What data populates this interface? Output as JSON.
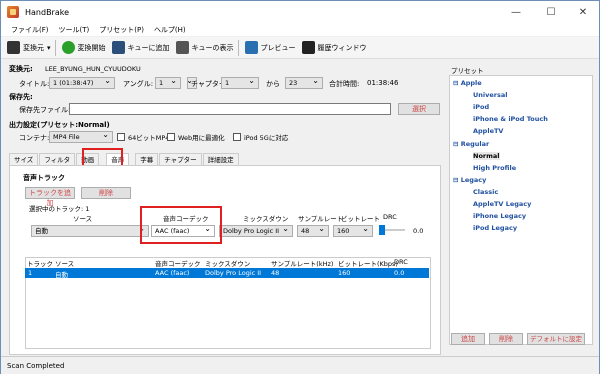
{
  "app": {
    "title": "HandBrake"
  },
  "menu": [
    "ファイル(F)",
    "ツール(T)",
    "プリセット(P)",
    "ヘルプ(H)"
  ],
  "toolbar": {
    "source": "変換元",
    "start": "変換開始",
    "add_queue": "キューに追加",
    "show_queue": "キューの表示",
    "preview": "プレビュー",
    "activity": "履歴ウィンドウ"
  },
  "source": {
    "label": "変換元:",
    "value": "LEE_BYUNG_HUN_CYUUDOKU",
    "title_label": "タイトル:",
    "title_value": "1 (01:38:47)",
    "angle_label": "アングル:",
    "angle_value": "1",
    "chapter_label": "チャプター:",
    "chapter_from": "1",
    "chapter_to_label": "から",
    "chapter_to": "23",
    "total_label": "合計時間:",
    "total_value": "01:38:46"
  },
  "destination": {
    "section": "保存先:",
    "file_label": "保存先ファイル:",
    "browse": "選択"
  },
  "output": {
    "section": "出力設定(プリセット:Normal)",
    "container_label": "コンテナ:",
    "container_value": "MP4 File",
    "opt_64bit": "64ビットMP4",
    "opt_web": "Web用に最適化",
    "opt_ipod": "iPod 5Gに対応"
  },
  "tabs": [
    "サイズ",
    "フィルタ",
    "動画",
    "音声",
    "字幕",
    "チャプター",
    "詳細設定"
  ],
  "audio": {
    "section": "音声トラック",
    "add_track": "トラックを追加",
    "remove": "削除",
    "selected_label": "選択中のトラック: 1",
    "col_source": "ソース",
    "col_codec": "音声コーデック",
    "col_mixdown": "ミックスダウン",
    "col_samplerate": "サンプルレート",
    "col_bitrate": "ビットレート",
    "col_drc": "DRC",
    "source_value": "自動",
    "codec_value": "AAC (faac)",
    "mixdown_value": "Dolby Pro Logic II",
    "samplerate_value": "48",
    "bitrate_value": "160",
    "drc_value": "0.0"
  },
  "table": {
    "headers": [
      "トラック",
      "ソース",
      "音声コーデック",
      "ミックスダウン",
      "サンプルレート(kHz)",
      "ビットレート(Kbps)",
      "DRC"
    ],
    "rows": [
      [
        "1",
        "自動",
        "AAC (faac)",
        "Dolby Pro Logic II",
        "48",
        "160",
        "0.0"
      ]
    ]
  },
  "presets": {
    "label": "プリセット",
    "groups": [
      {
        "name": "Apple",
        "items": [
          "Universal",
          "iPod",
          "iPhone & iPod Touch",
          "AppleTV"
        ]
      },
      {
        "name": "Regular",
        "items": [
          "Normal",
          "High Profile"
        ]
      },
      {
        "name": "Legacy",
        "items": [
          "Classic",
          "AppleTV Legacy",
          "iPhone Legacy",
          "iPod Legacy"
        ]
      }
    ],
    "add": "追加",
    "remove": "削除",
    "default": "デフォルトに設定"
  },
  "status": "Scan Completed"
}
